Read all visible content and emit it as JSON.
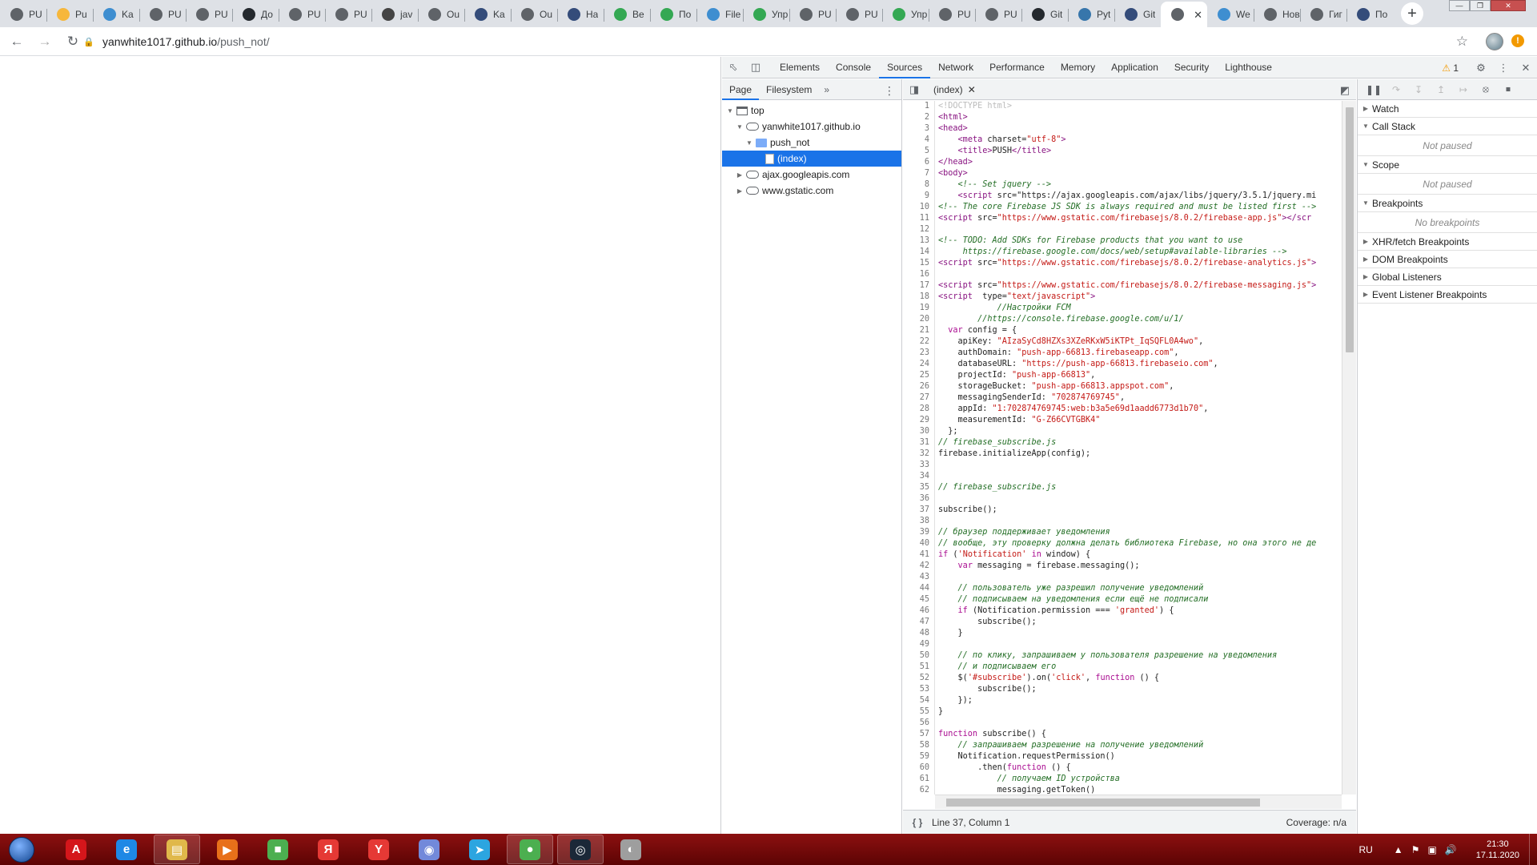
{
  "browser": {
    "tabs": [
      {
        "title": "PU",
        "color": "#5f6368"
      },
      {
        "title": "Pu",
        "color": "#f6b73c"
      },
      {
        "title": "Ka",
        "color": "#3e8ed0"
      },
      {
        "title": "PU",
        "color": "#5f6368"
      },
      {
        "title": "PU",
        "color": "#5f6368"
      },
      {
        "title": "До",
        "color": "#24292e"
      },
      {
        "title": "PU",
        "color": "#5f6368"
      },
      {
        "title": "PU",
        "color": "#5f6368"
      },
      {
        "title": "jav",
        "color": "#444444"
      },
      {
        "title": "Ou",
        "color": "#5f6368"
      },
      {
        "title": "Ka",
        "color": "#344c7a"
      },
      {
        "title": "Ou",
        "color": "#5f6368"
      },
      {
        "title": "Ha",
        "color": "#344c7a"
      },
      {
        "title": "Ве",
        "color": "#34a853"
      },
      {
        "title": "По",
        "color": "#34a853"
      },
      {
        "title": "File",
        "color": "#3e8ed0"
      },
      {
        "title": "Упр",
        "color": "#34a853"
      },
      {
        "title": "PU",
        "color": "#5f6368"
      },
      {
        "title": "PU",
        "color": "#5f6368"
      },
      {
        "title": "Упр",
        "color": "#34a853"
      },
      {
        "title": "PU",
        "color": "#5f6368"
      },
      {
        "title": "PU",
        "color": "#5f6368"
      },
      {
        "title": "Git",
        "color": "#24292e"
      },
      {
        "title": "Pyt",
        "color": "#3776ab"
      },
      {
        "title": "Git",
        "color": "#344c7a"
      },
      {
        "title": "",
        "color": "#5f6368",
        "active": true
      },
      {
        "title": "We",
        "color": "#3e8ed0"
      },
      {
        "title": "Новая",
        "color": "#5f6368"
      },
      {
        "title": "Гиг",
        "color": "#5f6368"
      },
      {
        "title": "По",
        "color": "#344c7a"
      }
    ],
    "url_host": "yanwhite1017.github.io",
    "url_path": "/push_not/"
  },
  "devtools": {
    "tabs": [
      "Elements",
      "Console",
      "Sources",
      "Network",
      "Performance",
      "Memory",
      "Application",
      "Security",
      "Lighthouse"
    ],
    "active_tab": "Sources",
    "warnings_count": "1",
    "navigator_tabs": [
      "Page",
      "Filesystem"
    ],
    "tree": [
      {
        "label": "top",
        "depth": 0,
        "icon": "frame",
        "expanded": true
      },
      {
        "label": "yanwhite1017.github.io",
        "depth": 1,
        "icon": "cloud",
        "expanded": true
      },
      {
        "label": "push_not",
        "depth": 2,
        "icon": "folder",
        "expanded": true
      },
      {
        "label": "(index)",
        "depth": 3,
        "icon": "file",
        "selected": true
      },
      {
        "label": "ajax.googleapis.com",
        "depth": 1,
        "icon": "cloud",
        "expanded": false
      },
      {
        "label": "www.gstatic.com",
        "depth": 1,
        "icon": "cloud",
        "expanded": false
      }
    ],
    "open_file": "(index)",
    "status_position": "Line 37, Column 1",
    "coverage": "Coverage: n/a",
    "debugger_panes": [
      {
        "title": "Watch",
        "expanded": false
      },
      {
        "title": "Call Stack",
        "expanded": true,
        "body": "Not paused"
      },
      {
        "title": "Scope",
        "expanded": true,
        "body": "Not paused"
      },
      {
        "title": "Breakpoints",
        "expanded": true,
        "body": "No breakpoints"
      },
      {
        "title": "XHR/fetch Breakpoints",
        "expanded": false
      },
      {
        "title": "DOM Breakpoints",
        "expanded": false
      },
      {
        "title": "Global Listeners",
        "expanded": false
      },
      {
        "title": "Event Listener Breakpoints",
        "expanded": false
      }
    ],
    "code_lines": [
      "<!DOCTYPE html>",
      "<html>",
      "<head>",
      "    <meta charset=\"utf-8\">",
      "    <title>PUSH</title>",
      "</head>",
      "<body>",
      "    <!-- Set jquery -->",
      "    <script src=\"https://ajax.googleapis.com/ajax/libs/jquery/3.5.1/jquery.mi",
      "<!-- The core Firebase JS SDK is always required and must be listed first -->",
      "<script src=\"https://www.gstatic.com/firebasejs/8.0.2/firebase-app.js\"></scr",
      "",
      "<!-- TODO: Add SDKs for Firebase products that you want to use",
      "     https://firebase.google.com/docs/web/setup#available-libraries -->",
      "<script src=\"https://www.gstatic.com/firebasejs/8.0.2/firebase-analytics.js\">",
      "",
      "<script src=\"https://www.gstatic.com/firebasejs/8.0.2/firebase-messaging.js\">",
      "<script  type=\"text/javascript\">",
      "            //Настройки FCM",
      "        //https://console.firebase.google.com/u/1/",
      "  var config = {",
      "    apiKey: \"AIzaSyCd8HZXs3XZeRKxW5iKTPt_IqSQFL0A4wo\",",
      "    authDomain: \"push-app-66813.firebaseapp.com\",",
      "    databaseURL: \"https://push-app-66813.firebaseio.com\",",
      "    projectId: \"push-app-66813\",",
      "    storageBucket: \"push-app-66813.appspot.com\",",
      "    messagingSenderId: \"702874769745\",",
      "    appId: \"1:702874769745:web:b3a5e69d1aadd6773d1b70\",",
      "    measurementId: \"G-Z66CVTGBK4\"",
      "  };",
      "// firebase_subscribe.js",
      "firebase.initializeApp(config);",
      "",
      "",
      "// firebase_subscribe.js",
      "",
      "subscribe();",
      "",
      "// браузер поддерживает уведомления",
      "// вообще, эту проверку должна делать библиотека Firebase, но она этого не де",
      "if ('Notification' in window) {",
      "    var messaging = firebase.messaging();",
      "",
      "    // пользователь уже разрешил получение уведомлений",
      "    // подписываем на уведомления если ещё не подписали",
      "    if (Notification.permission === 'granted') {",
      "        subscribe();",
      "    }",
      "",
      "    // по клику, запрашиваем у пользователя разрешение на уведомления",
      "    // и подписываем его",
      "    $('#subscribe').on('click', function () {",
      "        subscribe();",
      "    });",
      "}",
      "",
      "function subscribe() {",
      "    // запрашиваем разрешение на получение уведомлений",
      "    Notification.requestPermission()",
      "        .then(function () {",
      "            // получаем ID устройства",
      "            messaging.getToken()",
      ""
    ]
  },
  "taskbar": {
    "apps": [
      {
        "name": "acrobat",
        "glyph": "A",
        "color": "#d4161b"
      },
      {
        "name": "internet-explorer",
        "glyph": "e",
        "color": "#1e88e5"
      },
      {
        "name": "file-explorer",
        "glyph": "▤",
        "color": "#e0b84a",
        "pinned": true
      },
      {
        "name": "media-player",
        "glyph": "▶",
        "color": "#e8701a"
      },
      {
        "name": "rubiks-cube",
        "glyph": "■",
        "color": "#4caf50"
      },
      {
        "name": "yandex",
        "glyph": "Я",
        "color": "#e53935"
      },
      {
        "name": "yandex-browser",
        "glyph": "Y",
        "color": "#e53935"
      },
      {
        "name": "discord",
        "glyph": "◉",
        "color": "#7289da"
      },
      {
        "name": "telegram",
        "glyph": "➤",
        "color": "#2ca5e0"
      },
      {
        "name": "chrome",
        "glyph": "●",
        "color": "#4caf50",
        "pinned": true
      },
      {
        "name": "steam",
        "glyph": "◎",
        "color": "#1b2838",
        "pinned": true
      },
      {
        "name": "pinball",
        "glyph": "◐",
        "color": "#9e9e9e"
      }
    ],
    "lang": "RU",
    "time": "21:30",
    "date": "17.11.2020"
  }
}
